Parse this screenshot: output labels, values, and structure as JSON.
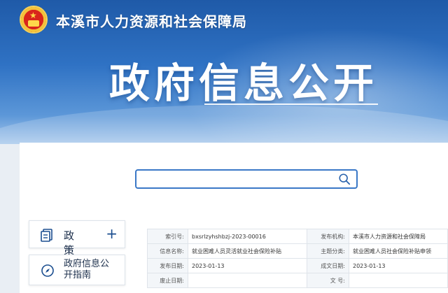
{
  "header": {
    "org_name": "本溪市人力资源和社会保障局",
    "main_title": "政府信息公开"
  },
  "search": {
    "placeholder": ""
  },
  "sidebar": {
    "items": [
      {
        "label": "政  策",
        "icon": "document-icon",
        "expand": "+"
      },
      {
        "label": "政府信息公开指南",
        "icon": "compass-icon"
      }
    ]
  },
  "info_table": {
    "rows": [
      {
        "k1": "索引号:",
        "v1": "bxsrlzyhshbzj-2023-00016",
        "k2": "发布机构:",
        "v2": "本溪市人力资源和社会保障局"
      },
      {
        "k1": "信息名称:",
        "v1": "就业困难人员灵活就业社会保险补贴",
        "k2": "主题分类:",
        "v2": "就业困难人员社会保险补贴申领"
      },
      {
        "k1": "发布日期:",
        "v1": "2023-01-13",
        "k2": "成文日期:",
        "v2": "2023-01-13"
      },
      {
        "k1": "废止日期:",
        "v1": "",
        "k2": "文 号:",
        "v2": ""
      }
    ]
  },
  "colors": {
    "banner": "#2f72c4",
    "accent": "#3a78c7"
  }
}
